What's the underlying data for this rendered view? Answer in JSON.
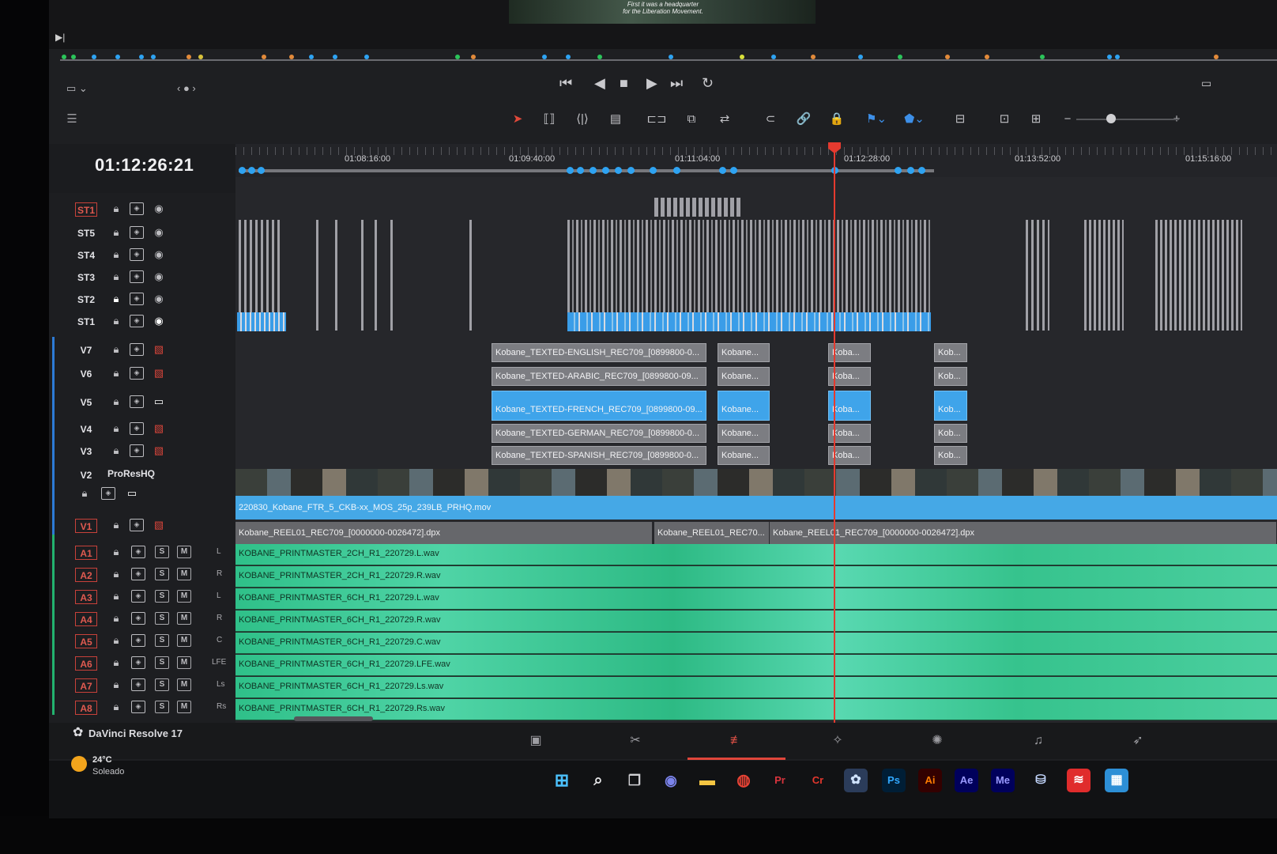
{
  "viewer": {
    "subtitle_line1": "First it was a headquarter",
    "subtitle_line2": "for the Liberation Movement."
  },
  "timeline": {
    "timecode": "01:12:26:21",
    "ruler_labels": [
      "01:08:16:00",
      "01:09:40:00",
      "01:11:04:00",
      "01:12:28:00",
      "01:13:52:00",
      "01:15:16:00"
    ]
  },
  "subtitle_tracks": [
    {
      "name": "ST1",
      "boxed": true
    },
    {
      "name": "ST5",
      "boxed": false
    },
    {
      "name": "ST4",
      "boxed": false
    },
    {
      "name": "ST3",
      "boxed": false
    },
    {
      "name": "ST2",
      "boxed": false
    },
    {
      "name": "ST1",
      "boxed": false
    }
  ],
  "video_tracks": [
    {
      "name": "V7"
    },
    {
      "name": "V6"
    },
    {
      "name": "V5"
    },
    {
      "name": "V4"
    },
    {
      "name": "V3"
    }
  ],
  "v2": {
    "name": "V2",
    "label": "ProResHQ",
    "clip": "220830_Kobane_FTR_5_CKB-xx_MOS_25p_239LB_PRHQ.mov"
  },
  "v1": {
    "name": "V1",
    "clips": [
      "Kobane_REEL01_REC709_[0000000-0026472].dpx",
      "Kobane_REEL01_REC70...",
      "Kobane_REEL01_REC709_[0000000-0026472].dpx"
    ]
  },
  "texted_clips": {
    "english": "Kobane_TEXTED-ENGLISH_REC709_[0899800-0...",
    "arabic": "Kobane_TEXTED-ARABIC_REC709_[0899800-09...",
    "french": "Kobane_TEXTED-FRENCH_REC709_[0899800-09...",
    "german": "Kobane_TEXTED-GERMAN_REC709_[0899800-0...",
    "spanish": "Kobane_TEXTED-SPANISH_REC709_[0899800-0...",
    "short": "Kobane...",
    "shorter": "Koba...",
    "shortest": "Kob..."
  },
  "audio_tracks": [
    {
      "name": "A1",
      "ch": "L",
      "clip": "KOBANE_PRINTMASTER_2CH_R1_220729.L.wav"
    },
    {
      "name": "A2",
      "ch": "R",
      "clip": "KOBANE_PRINTMASTER_2CH_R1_220729.R.wav"
    },
    {
      "name": "A3",
      "ch": "L",
      "clip": "KOBANE_PRINTMASTER_6CH_R1_220729.L.wav"
    },
    {
      "name": "A4",
      "ch": "R",
      "clip": "KOBANE_PRINTMASTER_6CH_R1_220729.R.wav"
    },
    {
      "name": "A5",
      "ch": "C",
      "clip": "KOBANE_PRINTMASTER_6CH_R1_220729.C.wav"
    },
    {
      "name": "A6",
      "ch": "LFE",
      "clip": "KOBANE_PRINTMASTER_6CH_R1_220729.LFE.wav"
    },
    {
      "name": "A7",
      "ch": "Ls",
      "clip": "KOBANE_PRINTMASTER_6CH_R1_220729.Ls.wav"
    },
    {
      "name": "A8",
      "ch": "Rs",
      "clip": "KOBANE_PRINTMASTER_6CH_R1_220729.Rs.wav"
    }
  ],
  "solo_label": "S",
  "mute_label": "M",
  "app": {
    "name": "DaVinci Resolve 17"
  },
  "weather": {
    "temp": "24°C",
    "desc": "Soleado"
  },
  "taskbar_apps": [
    {
      "label": "Pr",
      "color": "#d9343d",
      "bg": "transparent"
    },
    {
      "label": "Cr",
      "color": "#e2372d",
      "bg": "transparent"
    },
    {
      "label": "Ps",
      "color": "#31a8ff",
      "bg": "#001e36"
    },
    {
      "label": "Ai",
      "color": "#ff7c00",
      "bg": "#330000"
    },
    {
      "label": "Ae",
      "color": "#9999ff",
      "bg": "#00005b"
    },
    {
      "label": "Me",
      "color": "#9999ff",
      "bg": "#00005b"
    }
  ],
  "colors": {
    "playhead": "#e53a2f",
    "accent_blue": "#3fa4ea",
    "audio_green": "#2fc089"
  }
}
